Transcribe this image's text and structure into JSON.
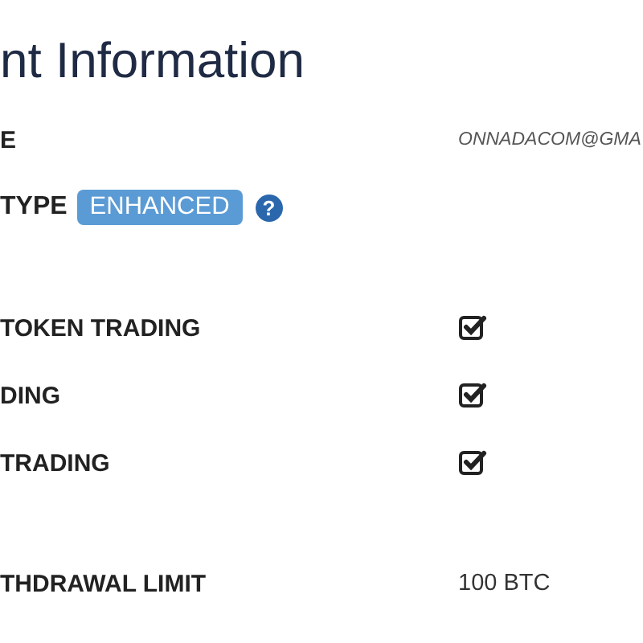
{
  "title": "nt Information",
  "sections": [
    [
      {
        "kind": "email",
        "label": "E",
        "value": "ONNADACOM@GMA"
      },
      {
        "kind": "badge",
        "label": "TYPE",
        "badge": "ENHANCED",
        "help": "?"
      }
    ],
    [
      {
        "kind": "check",
        "label": "TOKEN TRADING",
        "checked": true
      },
      {
        "kind": "check",
        "label": "DING",
        "checked": true
      },
      {
        "kind": "check",
        "label": "TRADING",
        "checked": true
      }
    ],
    [
      {
        "kind": "value",
        "label": "THDRAWAL LIMIT",
        "value": "100 BTC"
      }
    ]
  ]
}
